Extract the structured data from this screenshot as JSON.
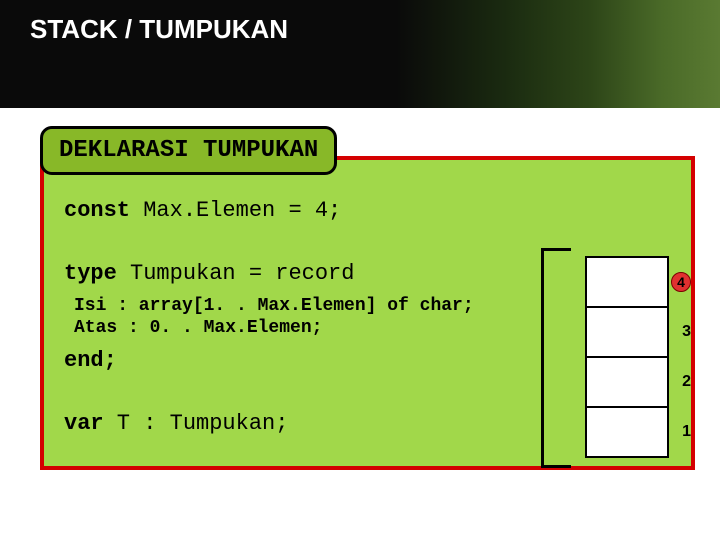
{
  "header": {
    "title": "STACK / TUMPUKAN"
  },
  "chip": {
    "label": "DEKLARASI TUMPUKAN"
  },
  "code": {
    "l1_kw": "const",
    "l1_rest": "  Max.Elemen = 4;",
    "l2_kw": "type",
    "l2_rest": " Tumpukan = record",
    "l3": "Isi : array[1. . Max.Elemen] of char;",
    "l4": "Atas : 0. . Max.Elemen;",
    "l5_kw": "end;",
    "l6_kw": "var",
    "l6_rest": " T : Tumpukan;"
  },
  "stack": {
    "labels": [
      "4",
      "3",
      "2",
      "1"
    ]
  }
}
